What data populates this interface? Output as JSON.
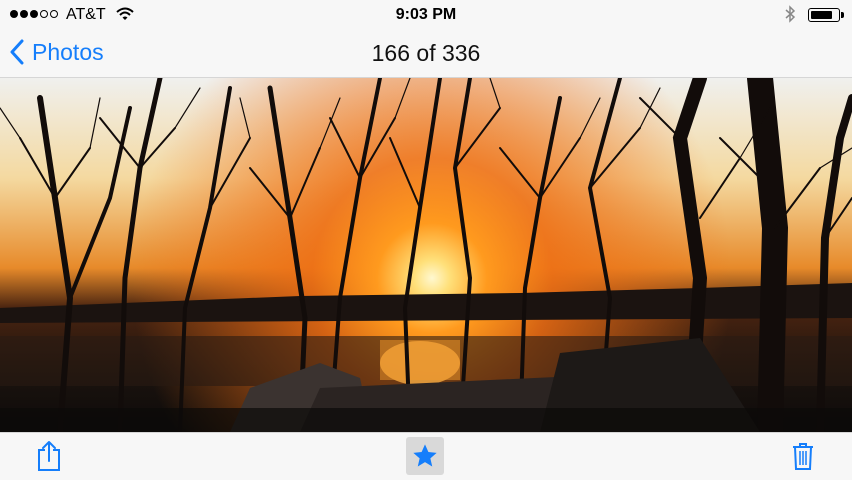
{
  "status_bar": {
    "signal_bars_filled": 3,
    "signal_bars_total": 5,
    "carrier": "AT&T",
    "time": "9:03 PM",
    "battery_level_fraction": 0.85
  },
  "nav": {
    "back_label": "Photos",
    "title": "166 of 336"
  },
  "photo": {
    "subject": "sunset-over-water-through-trees"
  },
  "toolbar": {
    "share_icon": "share-icon",
    "favorite_icon": "star-icon",
    "favorite_active": true,
    "delete_icon": "trash-icon"
  },
  "colors": {
    "accent": "#157efb",
    "bar_background": "#f7f7f7"
  }
}
